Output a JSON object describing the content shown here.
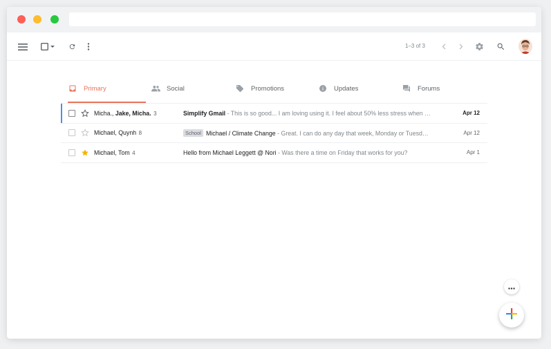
{
  "toolbar": {
    "pager_text": "1–3 of 3"
  },
  "tabs": [
    {
      "label": "Primary",
      "icon": "inbox-icon"
    },
    {
      "label": "Social",
      "icon": "people-icon"
    },
    {
      "label": "Promotions",
      "icon": "tag-icon"
    },
    {
      "label": "Updates",
      "icon": "info-icon"
    },
    {
      "label": "Forums",
      "icon": "forum-icon"
    }
  ],
  "emails": [
    {
      "sender_plain": "Micha., ",
      "sender_bold": "Jake, Micha.",
      "count": "3",
      "label": "",
      "subject": "Simplify Gmail",
      "snippet": " - This is so good... I am loving using it. I feel about 50% less stress when …",
      "date": "Apr 12",
      "starred": false,
      "unread": true
    },
    {
      "sender_plain": "Michael, Quynh",
      "sender_bold": "",
      "count": "8",
      "label": "School",
      "subject": "Michael / Climate Change",
      "snippet": " - Great. I can do any day that week, Monday or Tuesd…",
      "date": "Apr 12",
      "starred": false,
      "unread": false
    },
    {
      "sender_plain": "Michael, Tom",
      "sender_bold": "",
      "count": "4",
      "label": "",
      "subject": "Hello from Michael Leggett @ Nori",
      "snippet": " - Was there a time on Friday that works for you?",
      "date": "Apr 1",
      "starred": true,
      "unread": false
    }
  ],
  "colors": {
    "accent": "#e8735a",
    "selected_bar": "#4a90e2",
    "star_yellow": "#f4b400"
  }
}
